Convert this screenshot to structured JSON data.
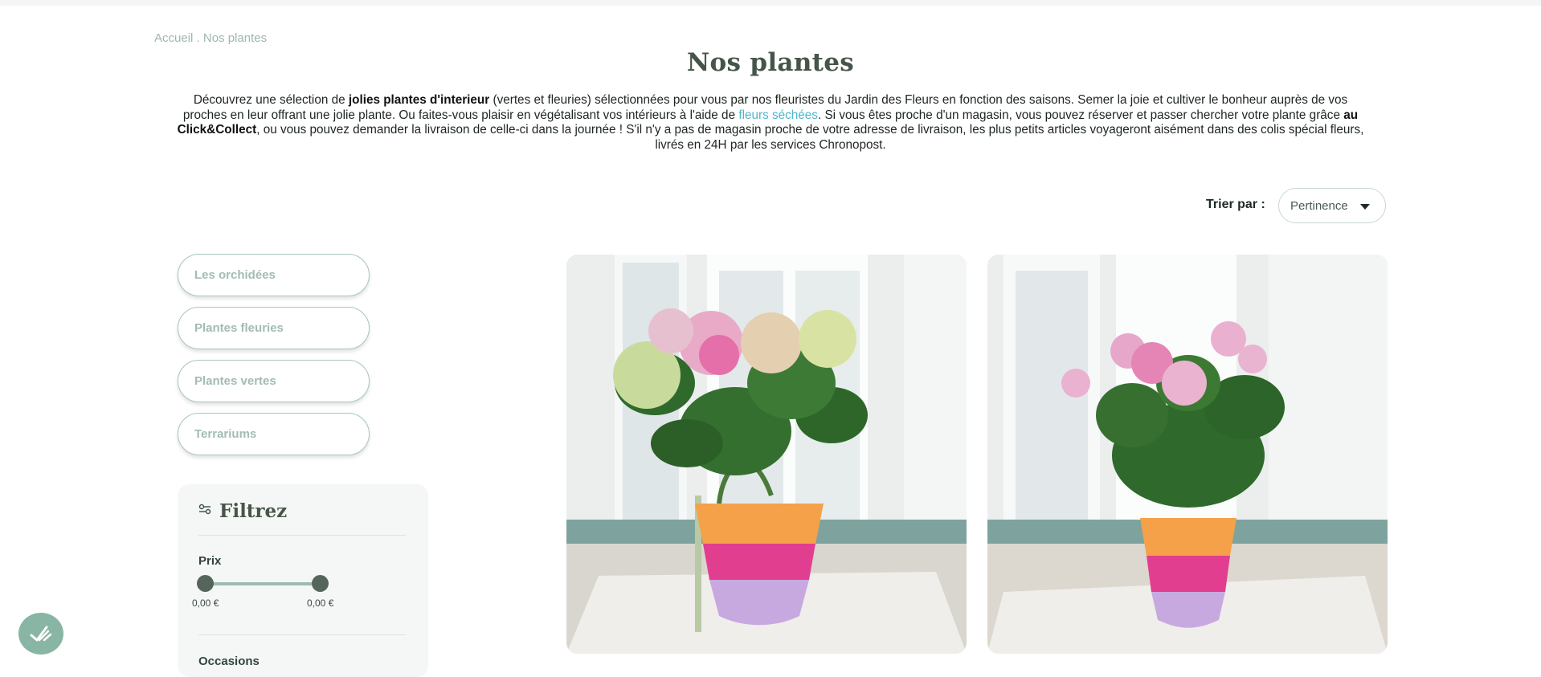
{
  "breadcrumb": {
    "home": "Accueil",
    "separator": " . ",
    "current": "Nos plantes"
  },
  "page": {
    "title": "Nos plantes",
    "intro": {
      "p1": "Découvrez une sélection de ",
      "b1": "jolies plantes d'interieur",
      "p2": " (vertes et fleuries) sélectionnées pour vous par nos fleuristes du Jardin des Fleurs en fonction des saisons. Semer la joie et cultiver le bonheur auprès de vos proches en leur offrant une jolie plante. Ou faites-vous plaisir en végétalisant vos intérieurs à l'aide de ",
      "link": "fleurs séchées",
      "p3": ". Si vous êtes proche d'un magasin, vous pouvez réserver et passer chercher votre plante grâce ",
      "b2": "au Click&Collect",
      "p4": ", ou vous pouvez demander la livraison de celle-ci dans la journée ! S'il n'y a pas de magasin proche de votre adresse de livraison, les plus petits articles voyageront aisément dans des colis spécial fleurs, livrés en 24H par les services Chronopost."
    }
  },
  "sort": {
    "label": "Trier par :",
    "selected": "Pertinence"
  },
  "categories": [
    "Les orchidées",
    "Plantes fleuries",
    "Plantes vertes",
    "Terrariums"
  ],
  "filters": {
    "title": "Filtrez",
    "price": {
      "label": "Prix",
      "min": "0,00 €",
      "max": "0,00 €"
    },
    "occasions_label": "Occasions"
  },
  "products": [
    {
      "image": "hydrangea-in-striped-basket-pot"
    },
    {
      "image": "pink-rose-plant-in-striped-basket-pot"
    }
  ],
  "icons": {
    "filter": "sliders-icon",
    "chat": "chat-icon",
    "sort_arrow": "chevron-down-icon"
  },
  "colors": {
    "brand": "#465549",
    "accent": "#88b5a4",
    "link": "#4fb6cd"
  }
}
